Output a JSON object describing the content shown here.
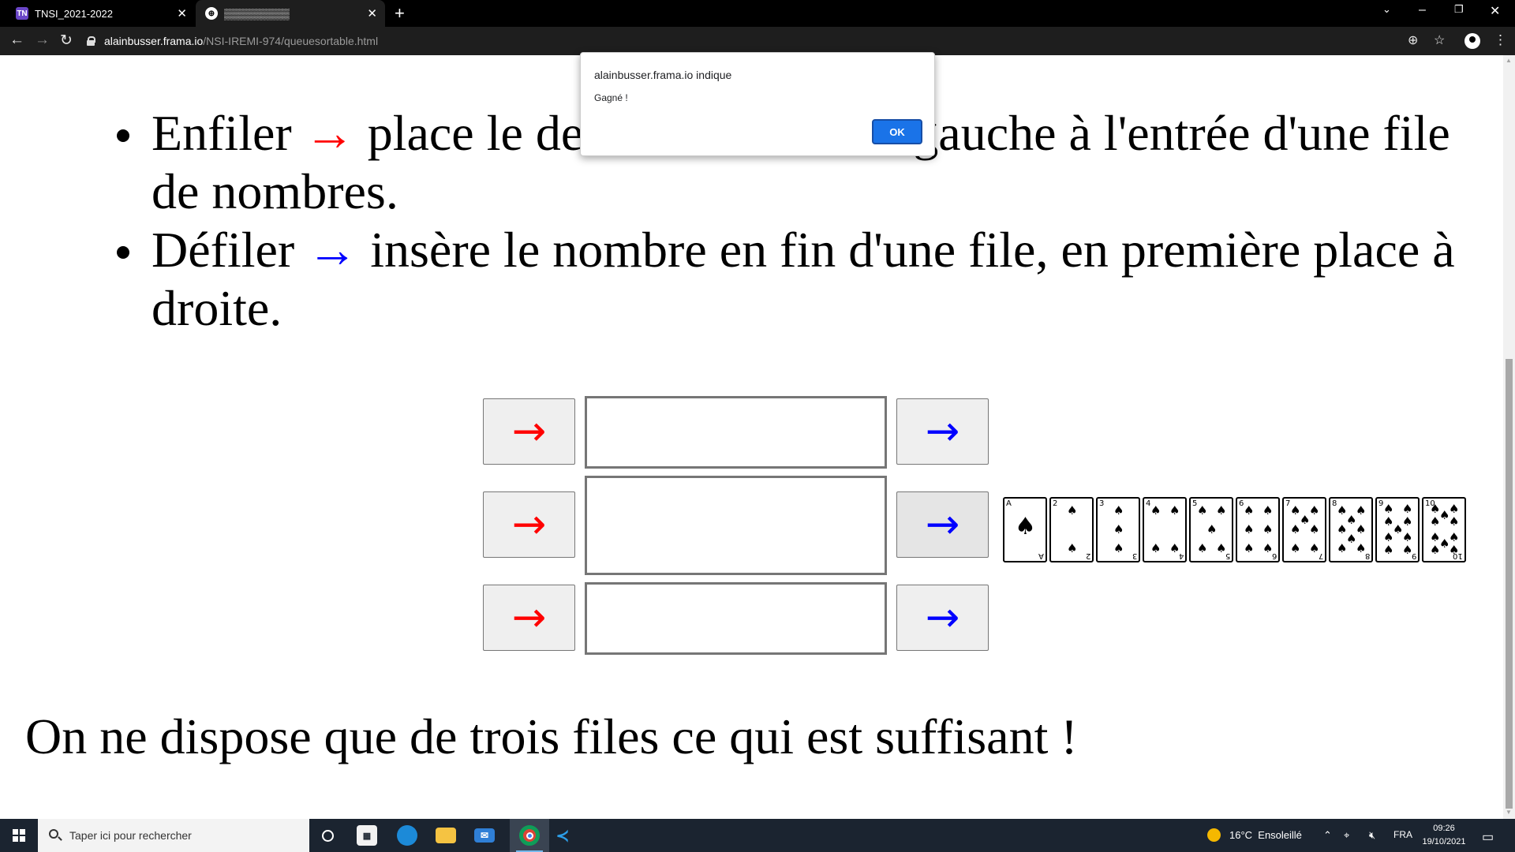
{
  "browser": {
    "tabs": [
      {
        "favicon": "TN",
        "title": "TNSI_2021-2022"
      },
      {
        "favicon": "⊕",
        "title": "▒▒▒▒▒▒▒▒▒"
      }
    ],
    "new_tab": "+",
    "url_host": "alainbusser.frama.io",
    "url_path": "/NSI-IREMI-974/queuesortable.html"
  },
  "page": {
    "bullets": [
      {
        "word": "Enfiler",
        "arrow": "→",
        "text_before_dialog": "place le de",
        "text_after_dialog": "gauche à l'entrée d'une file",
        "text_line2": "de nombres."
      },
      {
        "word": "Défiler",
        "arrow": "→",
        "text": "insère le nombre en fin d'une file, en première place à",
        "text_line2": "droite."
      }
    ],
    "queue_rows": [
      {
        "enqueue_label": "→",
        "dequeue_label": "→"
      },
      {
        "enqueue_label": "→",
        "dequeue_label": "→"
      },
      {
        "enqueue_label": "→",
        "dequeue_label": "→"
      }
    ],
    "cards": {
      "suit": "♠",
      "ranks": [
        "A",
        "2",
        "3",
        "4",
        "5",
        "6",
        "7",
        "8",
        "9",
        "10"
      ]
    },
    "footer": "On ne dispose que de trois files ce qui est suffisant !"
  },
  "alert": {
    "title": "alainbusser.frama.io indique",
    "message": "Gagné !",
    "ok_label": "OK"
  },
  "taskbar": {
    "search_placeholder": "Taper ici pour rechercher",
    "weather": "16°C  Ensoleillé",
    "language": "FRA",
    "time": "09:26",
    "date": "19/10/2021"
  },
  "colors": {
    "enqueue_arrow": "#ff0000",
    "dequeue_arrow": "#0000ff",
    "ok_button": "#1a73e8"
  },
  "icons": {
    "start": "windows-start-icon",
    "search": "search-icon",
    "task_view": "task-view-icon",
    "store": "store-icon",
    "edge": "edge-icon",
    "explorer": "file-explorer-icon",
    "mail": "mail-icon",
    "chrome": "chrome-icon",
    "vscode": "vscode-icon"
  }
}
